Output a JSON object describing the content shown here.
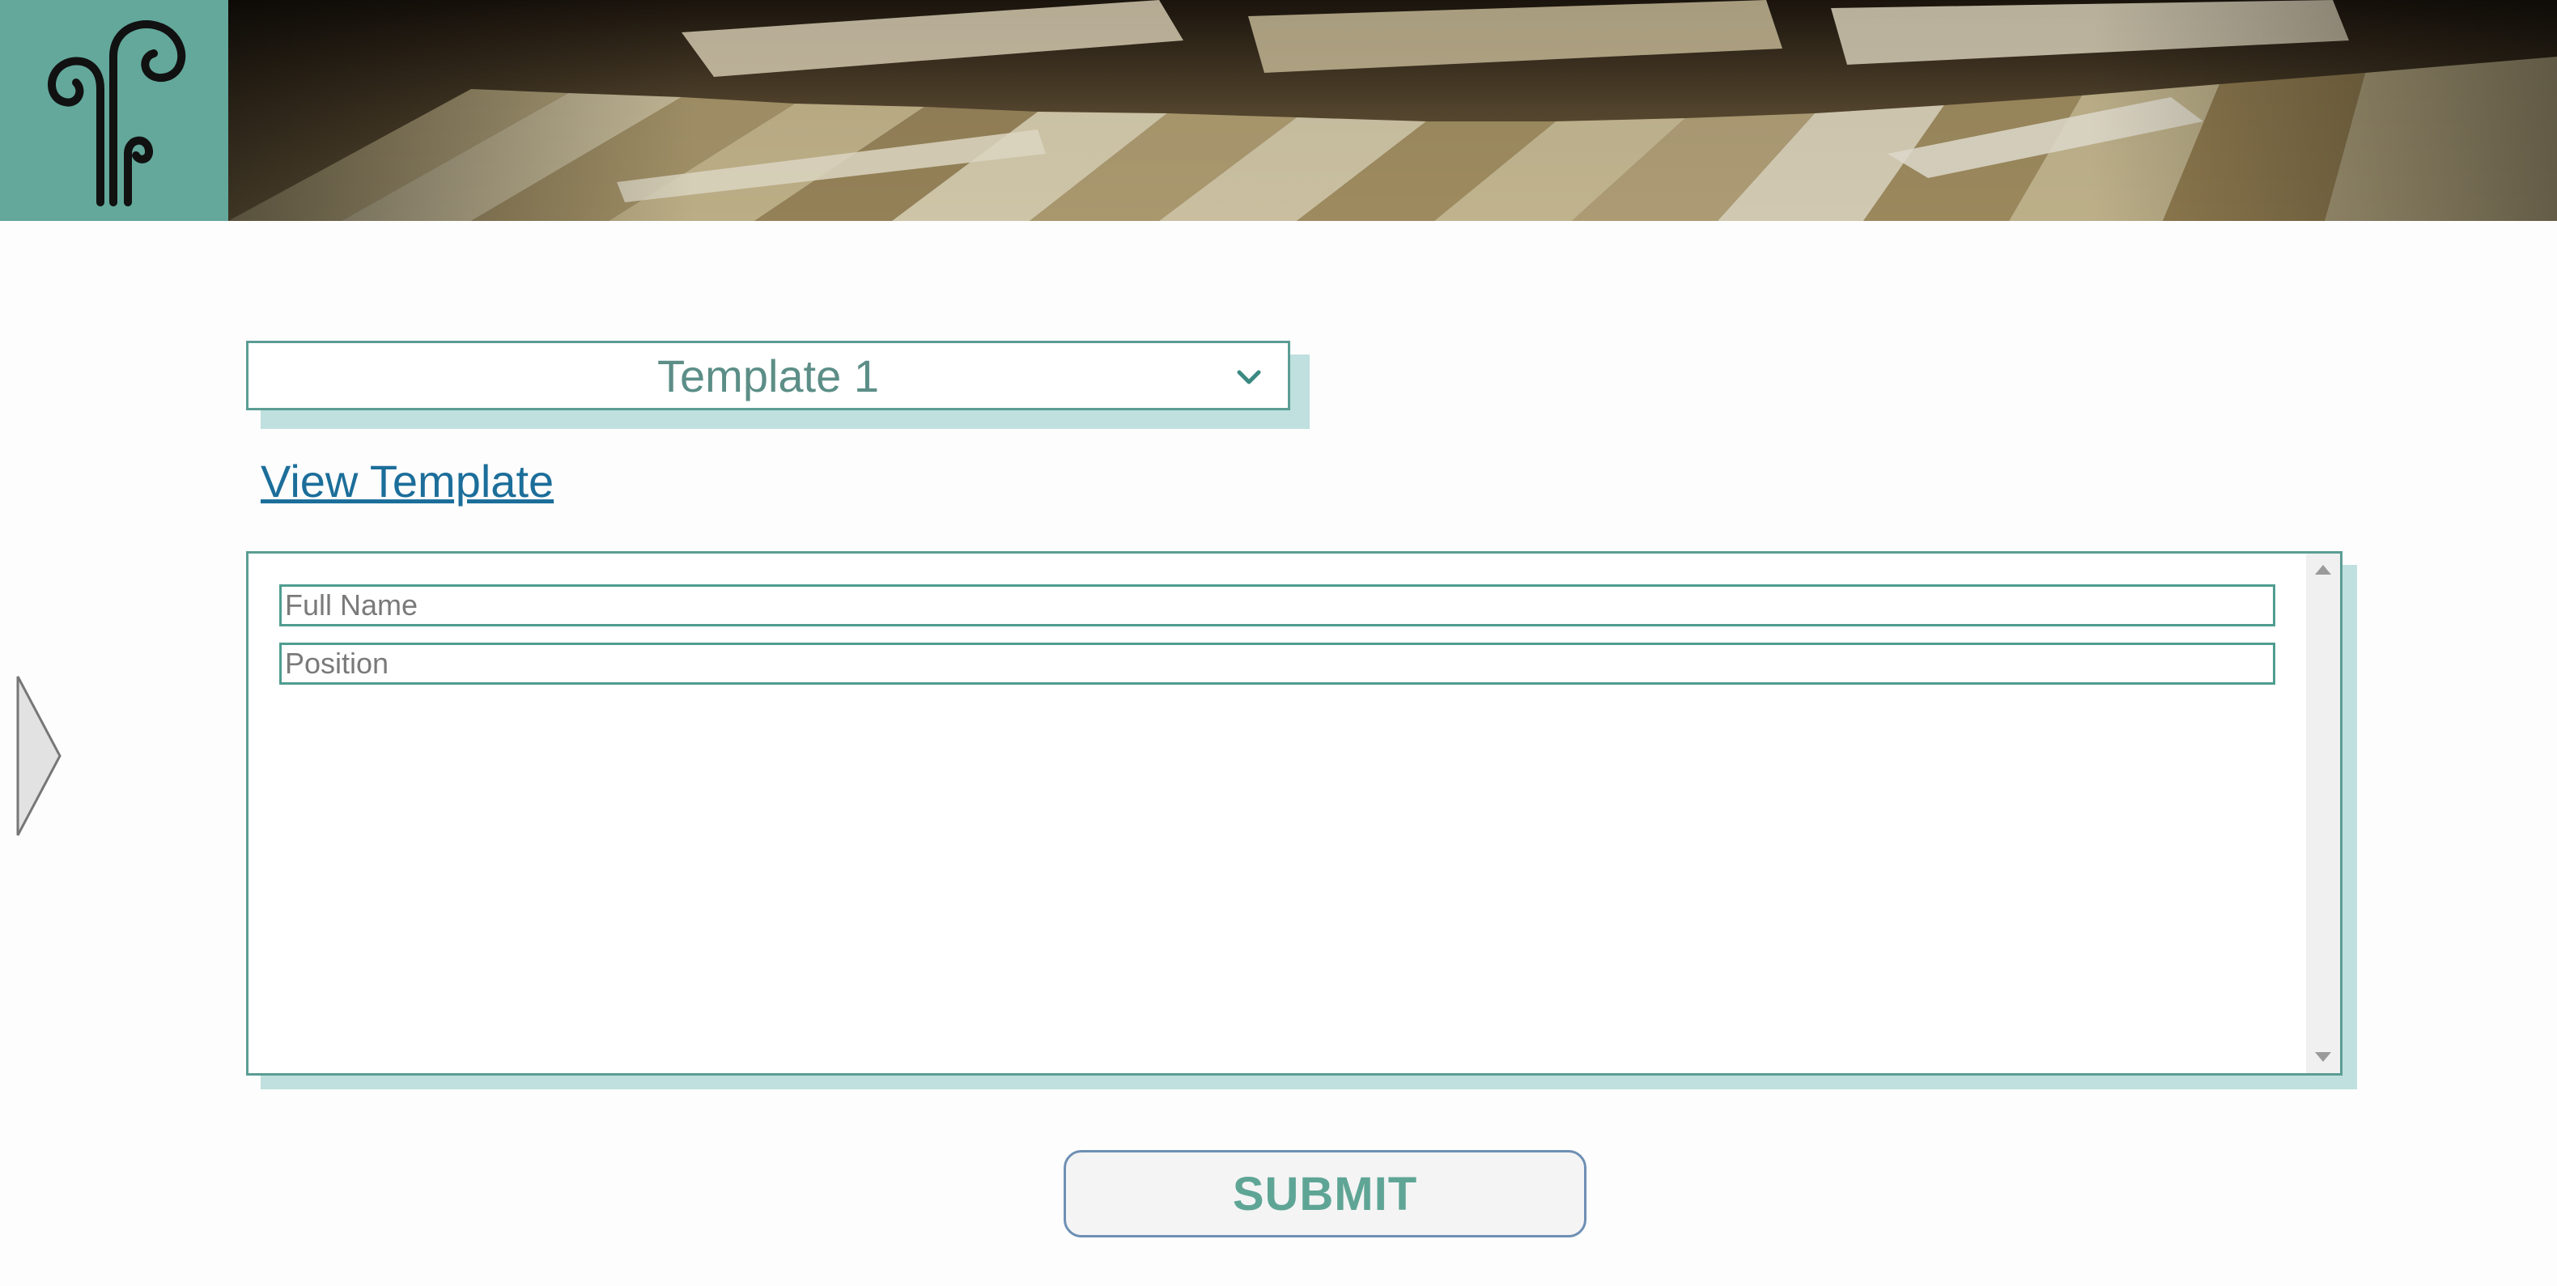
{
  "header": {
    "logo_icon": "fern-swirl-logo-icon",
    "banner_image": "record-crates-photo",
    "accent_color": "#63a89b"
  },
  "template_select": {
    "value": "Template 1",
    "icon": "chevron-down-icon"
  },
  "view_template_link": "View Template",
  "form": {
    "full_name": {
      "placeholder": "Full Name",
      "value": ""
    },
    "position": {
      "placeholder": "Position",
      "value": ""
    }
  },
  "side_nav": {
    "icon": "play-arrow-icon"
  },
  "submit_label": "SUBMIT"
}
